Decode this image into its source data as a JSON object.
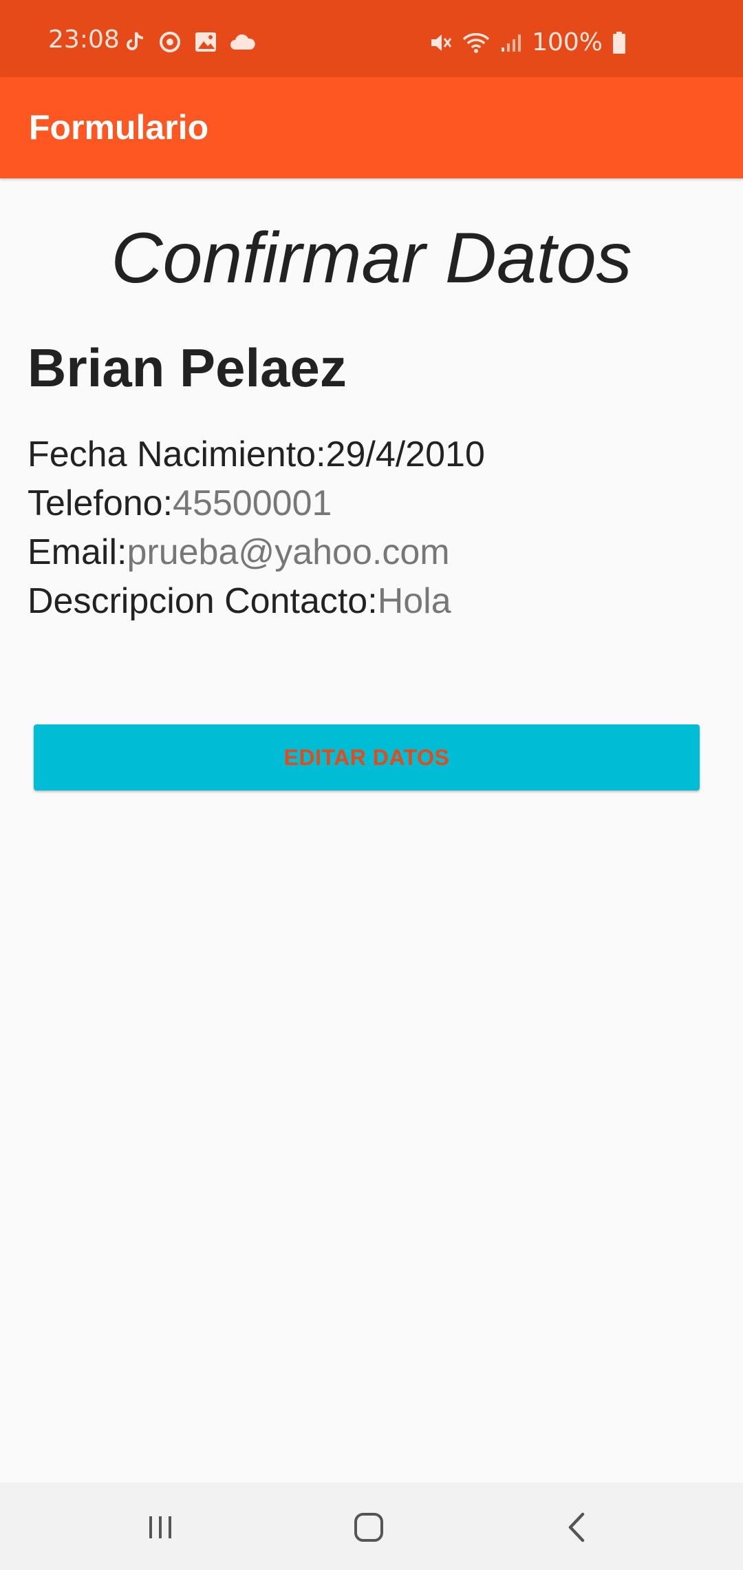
{
  "status_bar": {
    "time": "23:08",
    "battery": "100%",
    "left_icons": [
      "tiktok-icon",
      "sync-icon",
      "gallery-icon",
      "cloud-icon"
    ],
    "right_icons": [
      "mute-icon",
      "wifi-icon",
      "signal-icon",
      "battery-icon"
    ]
  },
  "app_bar": {
    "title": "Formulario"
  },
  "main": {
    "heading": "Confirmar Datos",
    "name": "Brian Pelaez",
    "fields": {
      "birth": {
        "label": "Fecha Nacimiento:",
        "value": "29/4/2010"
      },
      "phone": {
        "label": "Telefono:",
        "value": "45500001"
      },
      "email": {
        "label": "Email:",
        "value": "prueba@yahoo.com"
      },
      "description": {
        "label": "Descripcion Contacto:",
        "value": "Hola"
      }
    },
    "edit_button": "EDITAR DATOS"
  },
  "nav_bar": {
    "buttons": [
      "recent-apps-icon",
      "home-icon",
      "back-icon"
    ]
  },
  "colors": {
    "status_bar": "#e64a19",
    "app_bar": "#ff5722",
    "button_bg": "#00bcd4",
    "button_text": "#e64a19"
  }
}
